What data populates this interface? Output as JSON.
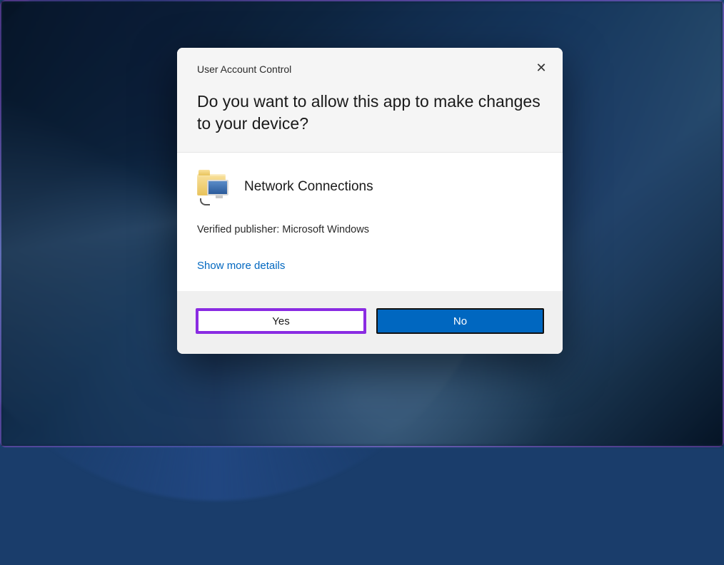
{
  "dialog": {
    "title": "User Account Control",
    "question": "Do you want to allow this app to make changes to your device?",
    "app_name": "Network Connections",
    "publisher_line": "Verified publisher: Microsoft Windows",
    "show_more": "Show more details",
    "yes_label": "Yes",
    "no_label": "No",
    "close_glyph": "✕",
    "icon_semantic": "network-connections-folder-icon"
  }
}
